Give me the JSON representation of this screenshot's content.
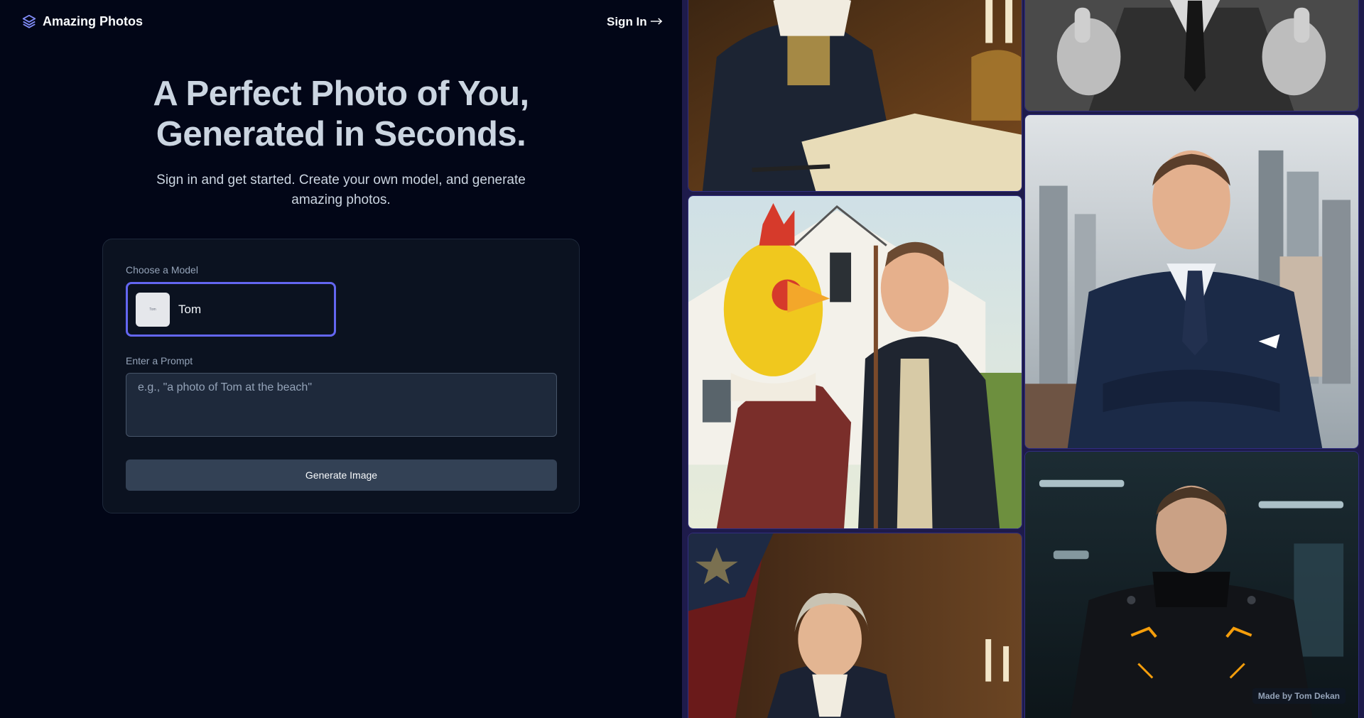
{
  "header": {
    "brand_name": "Amazing Photos",
    "brand_icon": "layers-icon",
    "sign_in_label": "Sign In",
    "sign_in_icon": "arrow-right-icon"
  },
  "hero": {
    "title_line1": "A Perfect Photo of You,",
    "title_line2": "Generated in Seconds.",
    "subtitle": "Sign in and get started. Create your own model, and generate amazing photos."
  },
  "form": {
    "model_label": "Choose a Model",
    "selected_model": "Tom",
    "model_thumb_text": "Tom",
    "prompt_label": "Enter a Prompt",
    "prompt_placeholder": "e.g., \"a photo of Tom at the beach\"",
    "prompt_value": "",
    "generate_label": "Generate Image"
  },
  "gallery": {
    "footer_credit": "Made by Tom Dekan"
  },
  "colors": {
    "background": "#020617",
    "card": "#0b1220",
    "accent": "#6366f1",
    "button": "#334155",
    "gallery_border": "#1e1b4b"
  }
}
